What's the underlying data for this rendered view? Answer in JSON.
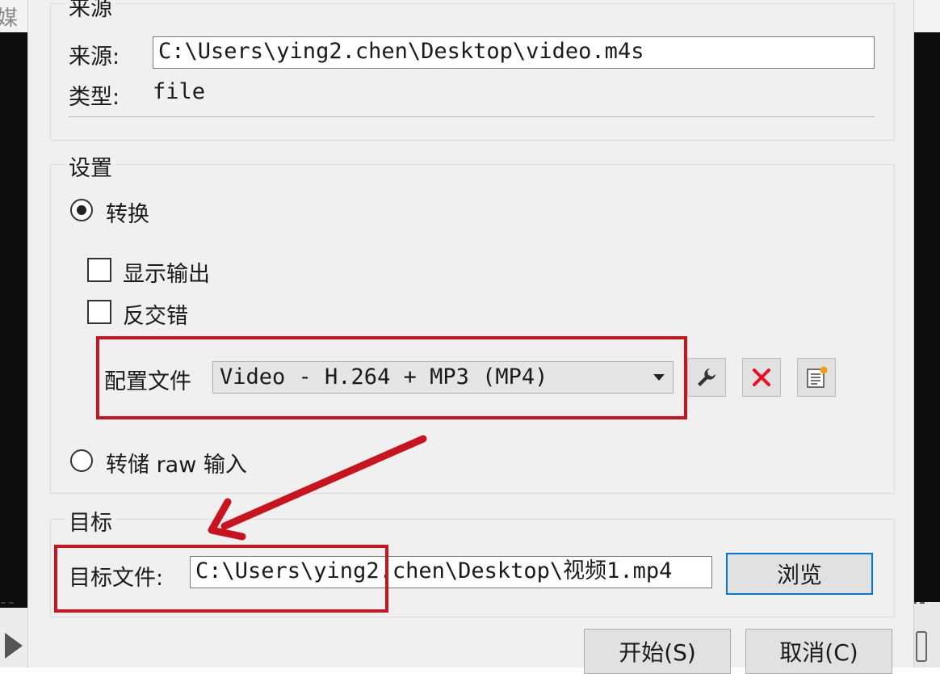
{
  "background": {
    "window_title_fragment": "媒",
    "dash_left": "--",
    "dash_right": "--"
  },
  "source_group": {
    "title": "来源",
    "source_label": "来源:",
    "source_value": "C:\\Users\\ying2.chen\\Desktop\\video.m4s",
    "type_label": "类型:",
    "type_value": "file"
  },
  "settings_group": {
    "title": "设置",
    "convert_label": "转换",
    "show_output_label": "显示输出",
    "deinterlace_label": "反交错",
    "profile_label": "配置文件",
    "profile_selected": "Video - H.264 + MP3 (MP4)",
    "dump_raw_label": "转储 raw 输入"
  },
  "destination_group": {
    "title": "目标",
    "dest_file_label": "目标文件:",
    "dest_file_value": "C:\\Users\\ying2.chen\\Desktop\\视频1.mp4",
    "browse_label": "浏览"
  },
  "footer": {
    "start_label": "开始(S)",
    "cancel_label": "取消(C)"
  },
  "colors": {
    "annotation": "#c8141e",
    "focus": "#0078d7",
    "delete_icon": "#e81123"
  }
}
